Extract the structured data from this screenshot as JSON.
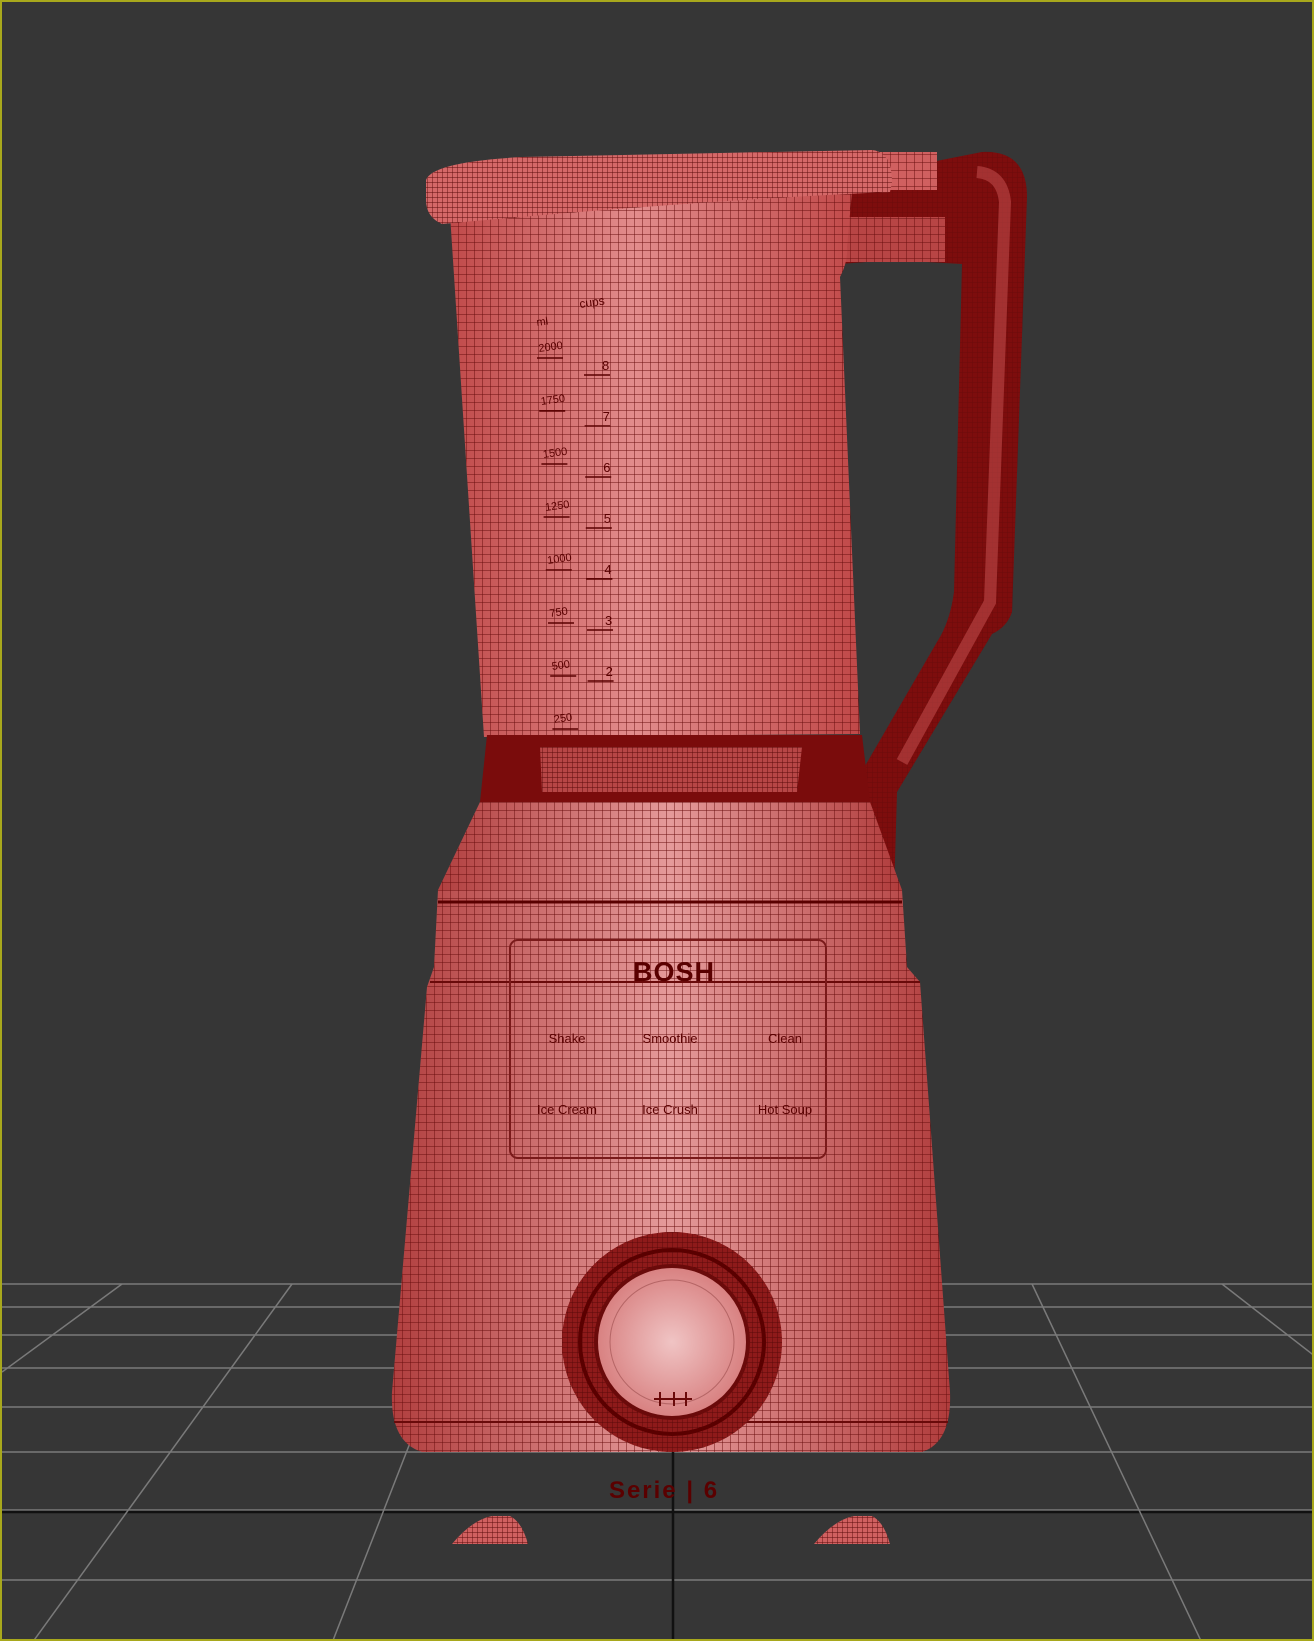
{
  "viewport": {
    "background": "#363636",
    "border_color": "#a8a81c",
    "grid_color": "#7a7a7a",
    "mesh_fill": "#cf5e5e",
    "wire_color": "#6a0f0f"
  },
  "blender": {
    "brand": "BOSH",
    "series": "Serie | 6",
    "ml_unit": "ml",
    "cups_unit": "cups",
    "ml_marks": [
      "2000",
      "1750",
      "1500",
      "1250",
      "1000",
      "750",
      "500",
      "250"
    ],
    "cup_marks": [
      "8",
      "7",
      "6",
      "5",
      "4",
      "3",
      "2"
    ],
    "programs": [
      "Shake",
      "Smoothie",
      "Clean",
      "Ice Cream",
      "Ice Crush",
      "Hot Soup"
    ]
  }
}
